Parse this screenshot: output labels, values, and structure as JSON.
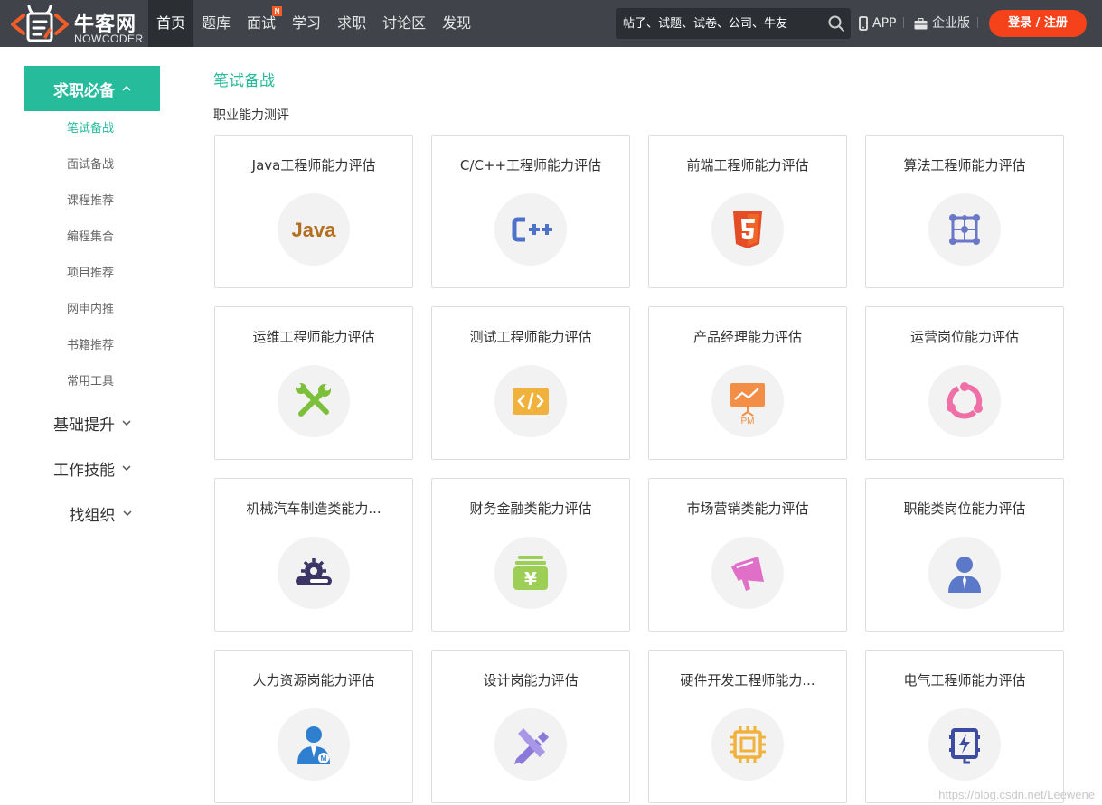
{
  "header": {
    "logo_cn": "牛客网",
    "logo_en": "NOWCODER",
    "nav": [
      {
        "label": "首页",
        "active": true
      },
      {
        "label": "题库"
      },
      {
        "label": "面试",
        "badge": "N"
      },
      {
        "label": "学习"
      },
      {
        "label": "求职"
      },
      {
        "label": "讨论区"
      },
      {
        "label": "发现"
      }
    ],
    "search_placeholder": "帖子、试题、试卷、公司、牛友",
    "app_label": "APP",
    "enterprise_label": "企业版",
    "login_label": "登录 / 注册"
  },
  "sidebar": {
    "head": "求职必备",
    "subs": [
      "笔试备战",
      "面试备战",
      "课程推荐",
      "编程集合",
      "项目推荐",
      "网申内推",
      "书籍推荐",
      "常用工具"
    ],
    "groups": [
      "基础提升",
      "工作技能",
      "找组织"
    ]
  },
  "main": {
    "title": "笔试备战",
    "section": "职业能力测评",
    "cards": [
      {
        "title": "Java工程师能力评估",
        "icon": "java-icon"
      },
      {
        "title": "C/C++工程师能力评估",
        "icon": "cpp-icon"
      },
      {
        "title": "前端工程师能力评估",
        "icon": "html5-icon"
      },
      {
        "title": "算法工程师能力评估",
        "icon": "algorithm-icon"
      },
      {
        "title": "运维工程师能力评估",
        "icon": "tools-icon"
      },
      {
        "title": "测试工程师能力评估",
        "icon": "code-icon"
      },
      {
        "title": "产品经理能力评估",
        "icon": "pm-icon"
      },
      {
        "title": "运营岗位能力评估",
        "icon": "cycle-icon"
      },
      {
        "title": "机械汽车制造类能力...",
        "icon": "machinery-icon"
      },
      {
        "title": "财务金融类能力评估",
        "icon": "finance-icon"
      },
      {
        "title": "市场营销类能力评估",
        "icon": "megaphone-icon"
      },
      {
        "title": "职能类岗位能力评估",
        "icon": "person-icon"
      },
      {
        "title": "人力资源岗能力评估",
        "icon": "hr-icon"
      },
      {
        "title": "设计岗能力评估",
        "icon": "design-icon"
      },
      {
        "title": "硬件开发工程师能力...",
        "icon": "chip-icon"
      },
      {
        "title": "电气工程师能力评估",
        "icon": "electric-icon"
      }
    ]
  },
  "watermark": "https://blog.csdn.net/Leewene",
  "colors": {
    "accent": "#25bb9b",
    "header": "#40444a",
    "login": "#f5421b"
  }
}
